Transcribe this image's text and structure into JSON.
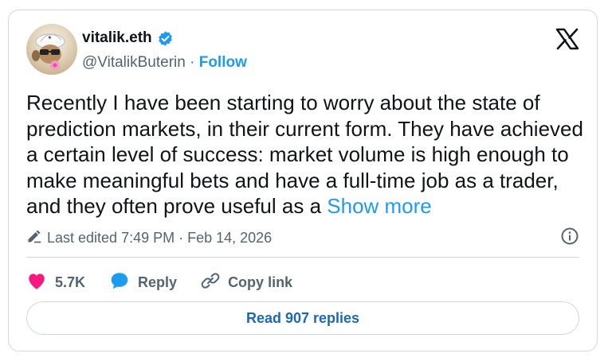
{
  "author": {
    "name": "vitalik.eth",
    "handle": "@VitalikButerin",
    "separator": "·",
    "follow_label": "Follow"
  },
  "tweet": {
    "text": "Recently I have been starting to worry about the state of prediction markets, in their current form. They have achieved a certain level of success: market volume is high enough to make meaningful bets and have a full-time job as a trader, and they often prove useful as a",
    "show_more_label": "Show more",
    "edited_label": "Last edited 7:49 PM · Feb 14, 2026"
  },
  "actions": {
    "like_count": "5.7K",
    "reply_label": "Reply",
    "copy_link_label": "Copy link"
  },
  "read_replies_label": "Read 907 replies",
  "icons": {
    "verified": "verified-badge-icon",
    "x_logo": "x-logo-icon",
    "edit": "pencil-icon",
    "info": "info-icon",
    "like": "heart-icon",
    "reply": "speech-bubble-icon",
    "copy_link": "link-icon"
  },
  "colors": {
    "accent": "#1d9bf0",
    "like": "#f91880",
    "muted": "#536471",
    "border": "#cfd9de"
  }
}
